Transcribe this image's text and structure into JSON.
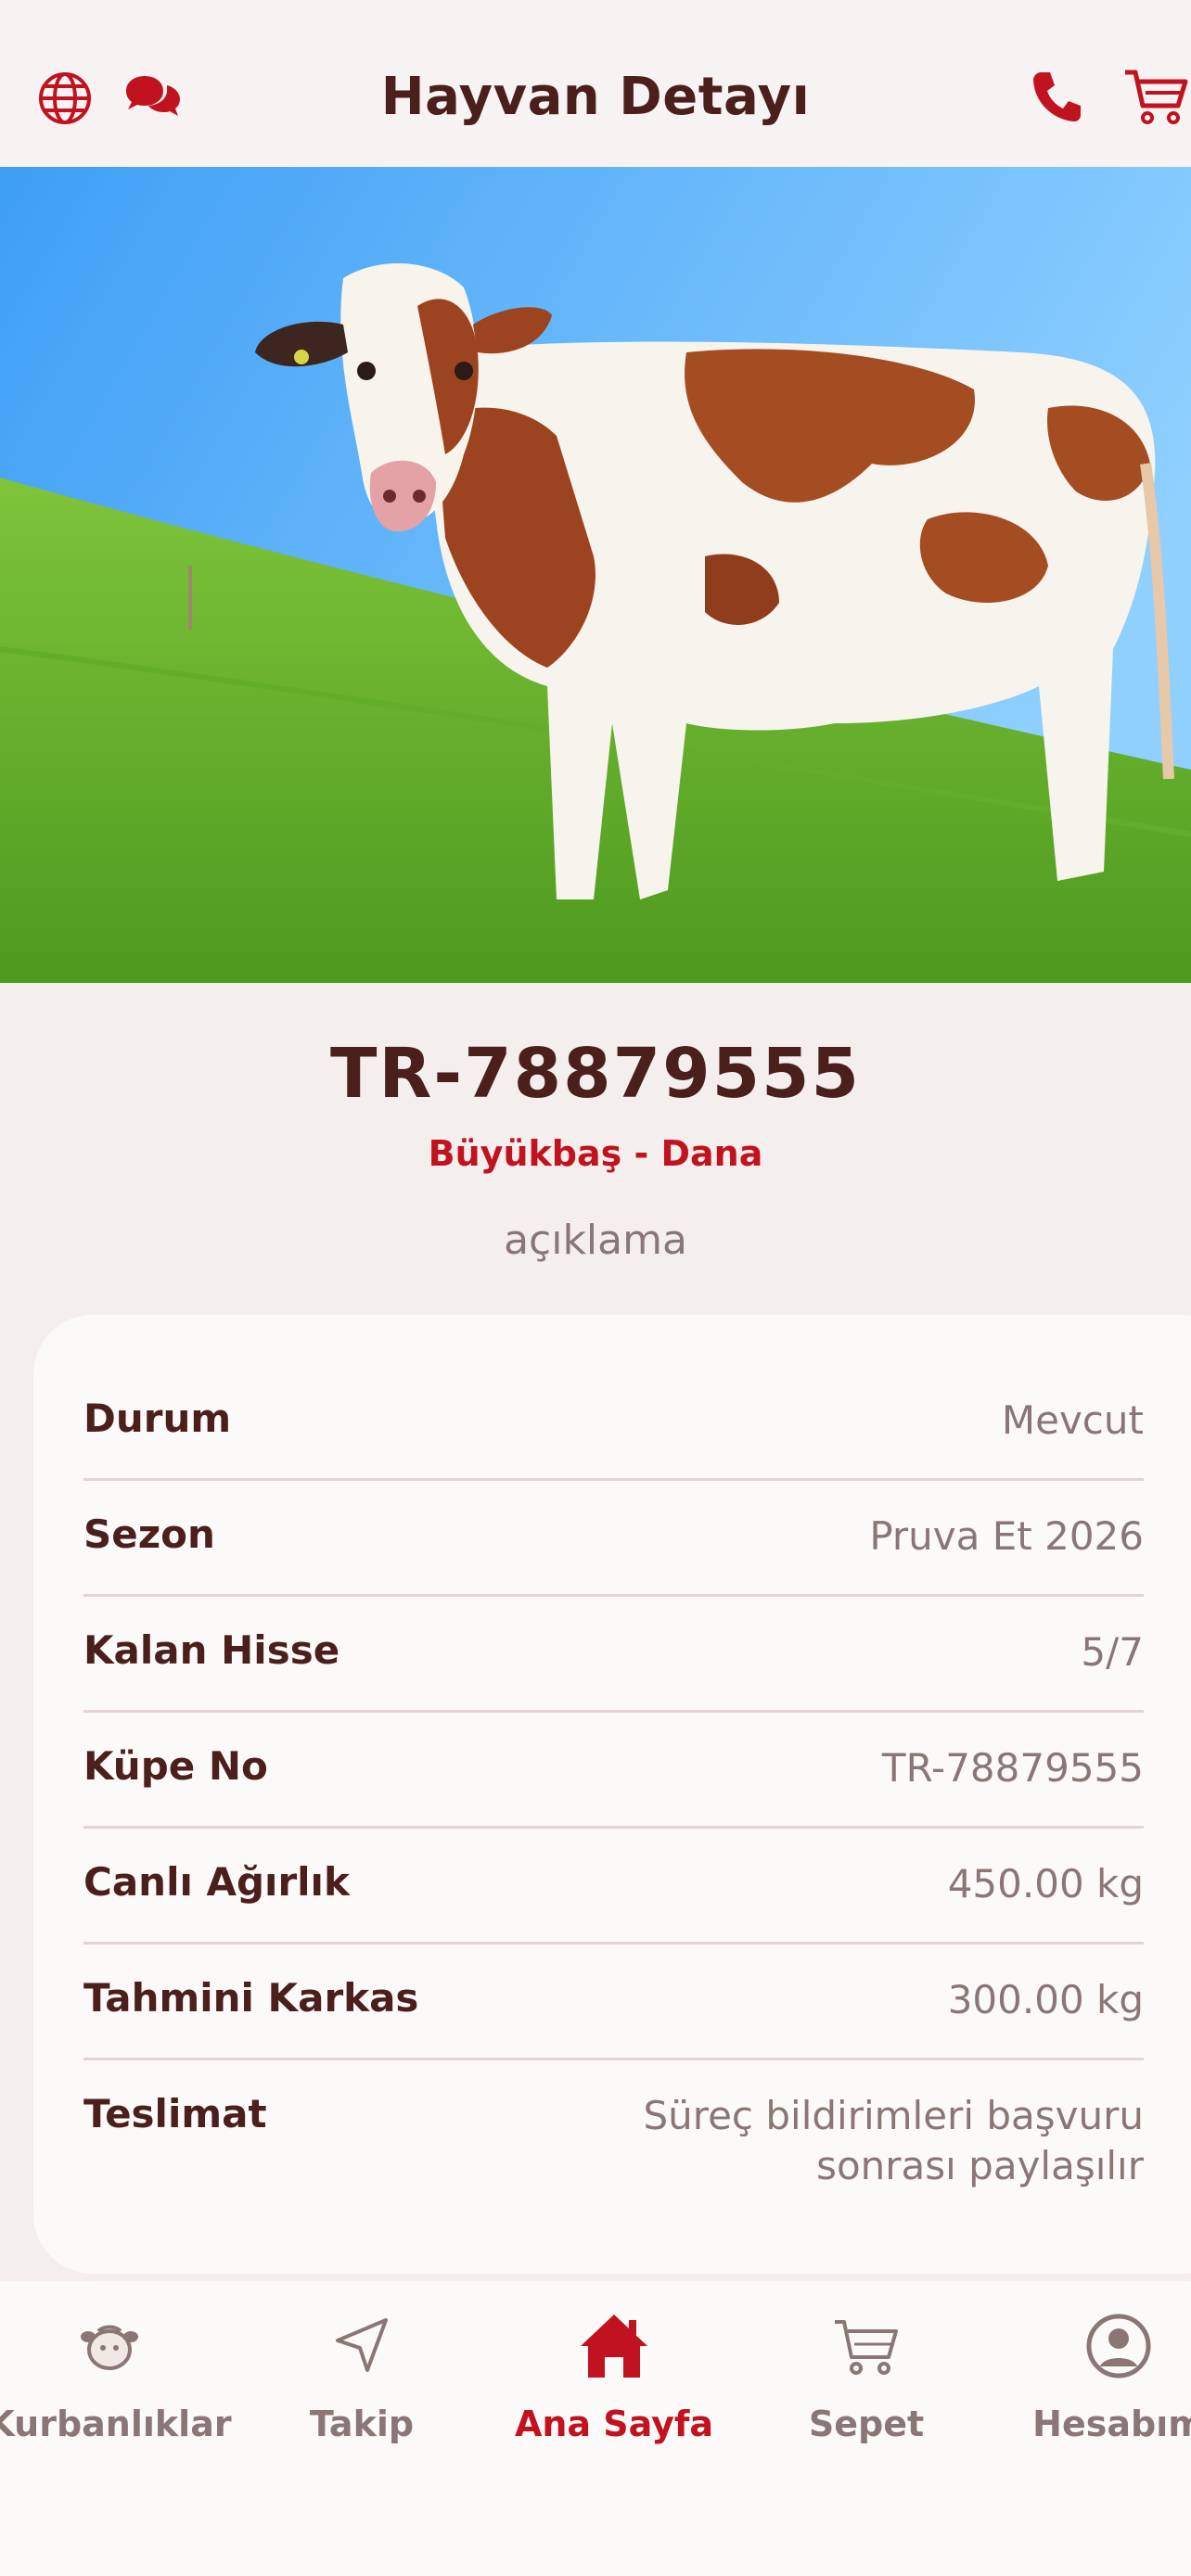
{
  "header": {
    "title": "Hayvan Detayı",
    "left_icons": [
      "globe-icon",
      "chat-icon"
    ],
    "right_icons": [
      "phone-icon",
      "cart-icon"
    ]
  },
  "hero": {
    "image": "cow-photo"
  },
  "animal": {
    "tag_no": "TR-78879555",
    "category": "Büyükbaş - Dana",
    "description": "açıklama"
  },
  "details": [
    {
      "label": "Durum",
      "value": "Mevcut"
    },
    {
      "label": "Sezon",
      "value": "Pruva Et 2026"
    },
    {
      "label": "Kalan Hisse",
      "value": "5/7"
    },
    {
      "label": "Küpe No",
      "value": "TR-78879555"
    },
    {
      "label": "Canlı Ağırlık",
      "value": "450.00 kg"
    },
    {
      "label": "Tahmini Karkas",
      "value": "300.00 kg"
    },
    {
      "label": "Teslimat",
      "value_line1": "Süreç bildirimleri başvuru",
      "value_line2": "sonrası paylaşılır"
    }
  ],
  "nav": [
    {
      "label": "Kurbanlıklar",
      "icon": "sheep-icon"
    },
    {
      "label": "Takip",
      "icon": "navigation-arrow-icon"
    },
    {
      "label": "Ana Sayfa",
      "icon": "home-icon",
      "active": true
    },
    {
      "label": "Sepet",
      "icon": "cart-icon"
    },
    {
      "label": "Hesabım",
      "icon": "account-icon"
    }
  ],
  "colors": {
    "accent": "#c1121f",
    "text_dark": "#4a1f1c",
    "text_muted": "#8a7775",
    "background": "#f4efed",
    "card": "#fcfaf9"
  }
}
